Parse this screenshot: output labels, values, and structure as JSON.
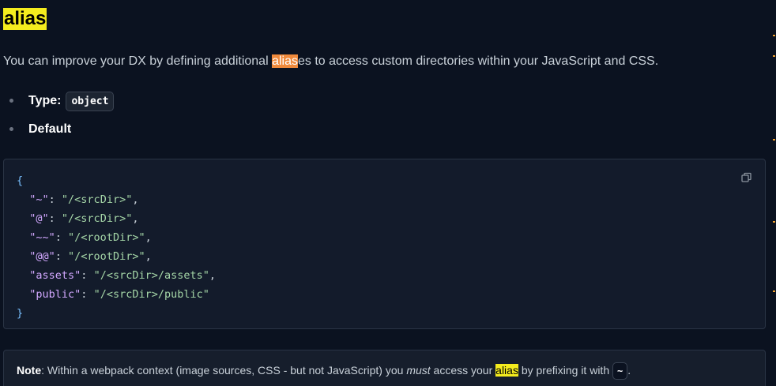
{
  "heading": "alias",
  "intro": {
    "before": "You can improve your DX by defining additional ",
    "highlight": "alias",
    "after": "es to access custom directories within your JavaScript and CSS."
  },
  "props": {
    "type_label": "Type",
    "type_sep": ":",
    "type_value": "object",
    "default_label": "Default"
  },
  "code": {
    "open": "{",
    "close": "}",
    "lines": [
      {
        "key": "\"~\"",
        "value": "\"/<srcDir>\"",
        "trail": ","
      },
      {
        "key": "\"@\"",
        "value": "\"/<srcDir>\"",
        "trail": ","
      },
      {
        "key": "\"~~\"",
        "value": "\"/<rootDir>\"",
        "trail": ","
      },
      {
        "key": "\"@@\"",
        "value": "\"/<rootDir>\"",
        "trail": ","
      },
      {
        "key": "\"assets\"",
        "value": "\"/<srcDir>/assets\"",
        "trail": ","
      },
      {
        "key": "\"public\"",
        "value": "\"/<srcDir>/public\"",
        "trail": ""
      }
    ]
  },
  "note": {
    "label": "Note",
    "text_1": ": Within a webpack context (image sources, CSS - but not JavaScript) you ",
    "emphasis": "must",
    "text_2": " access your ",
    "highlight": "alias",
    "text_3": " by prefixing it with ",
    "code": "~",
    "text_4": "."
  },
  "colors": {
    "background": "#0b1220",
    "highlight_yellow": "#f4ec1e",
    "highlight_orange": "#f08a3c",
    "code_key": "#d2a8ff",
    "code_string": "#a5d6a7"
  },
  "icons": {
    "copy": "copy-icon"
  }
}
